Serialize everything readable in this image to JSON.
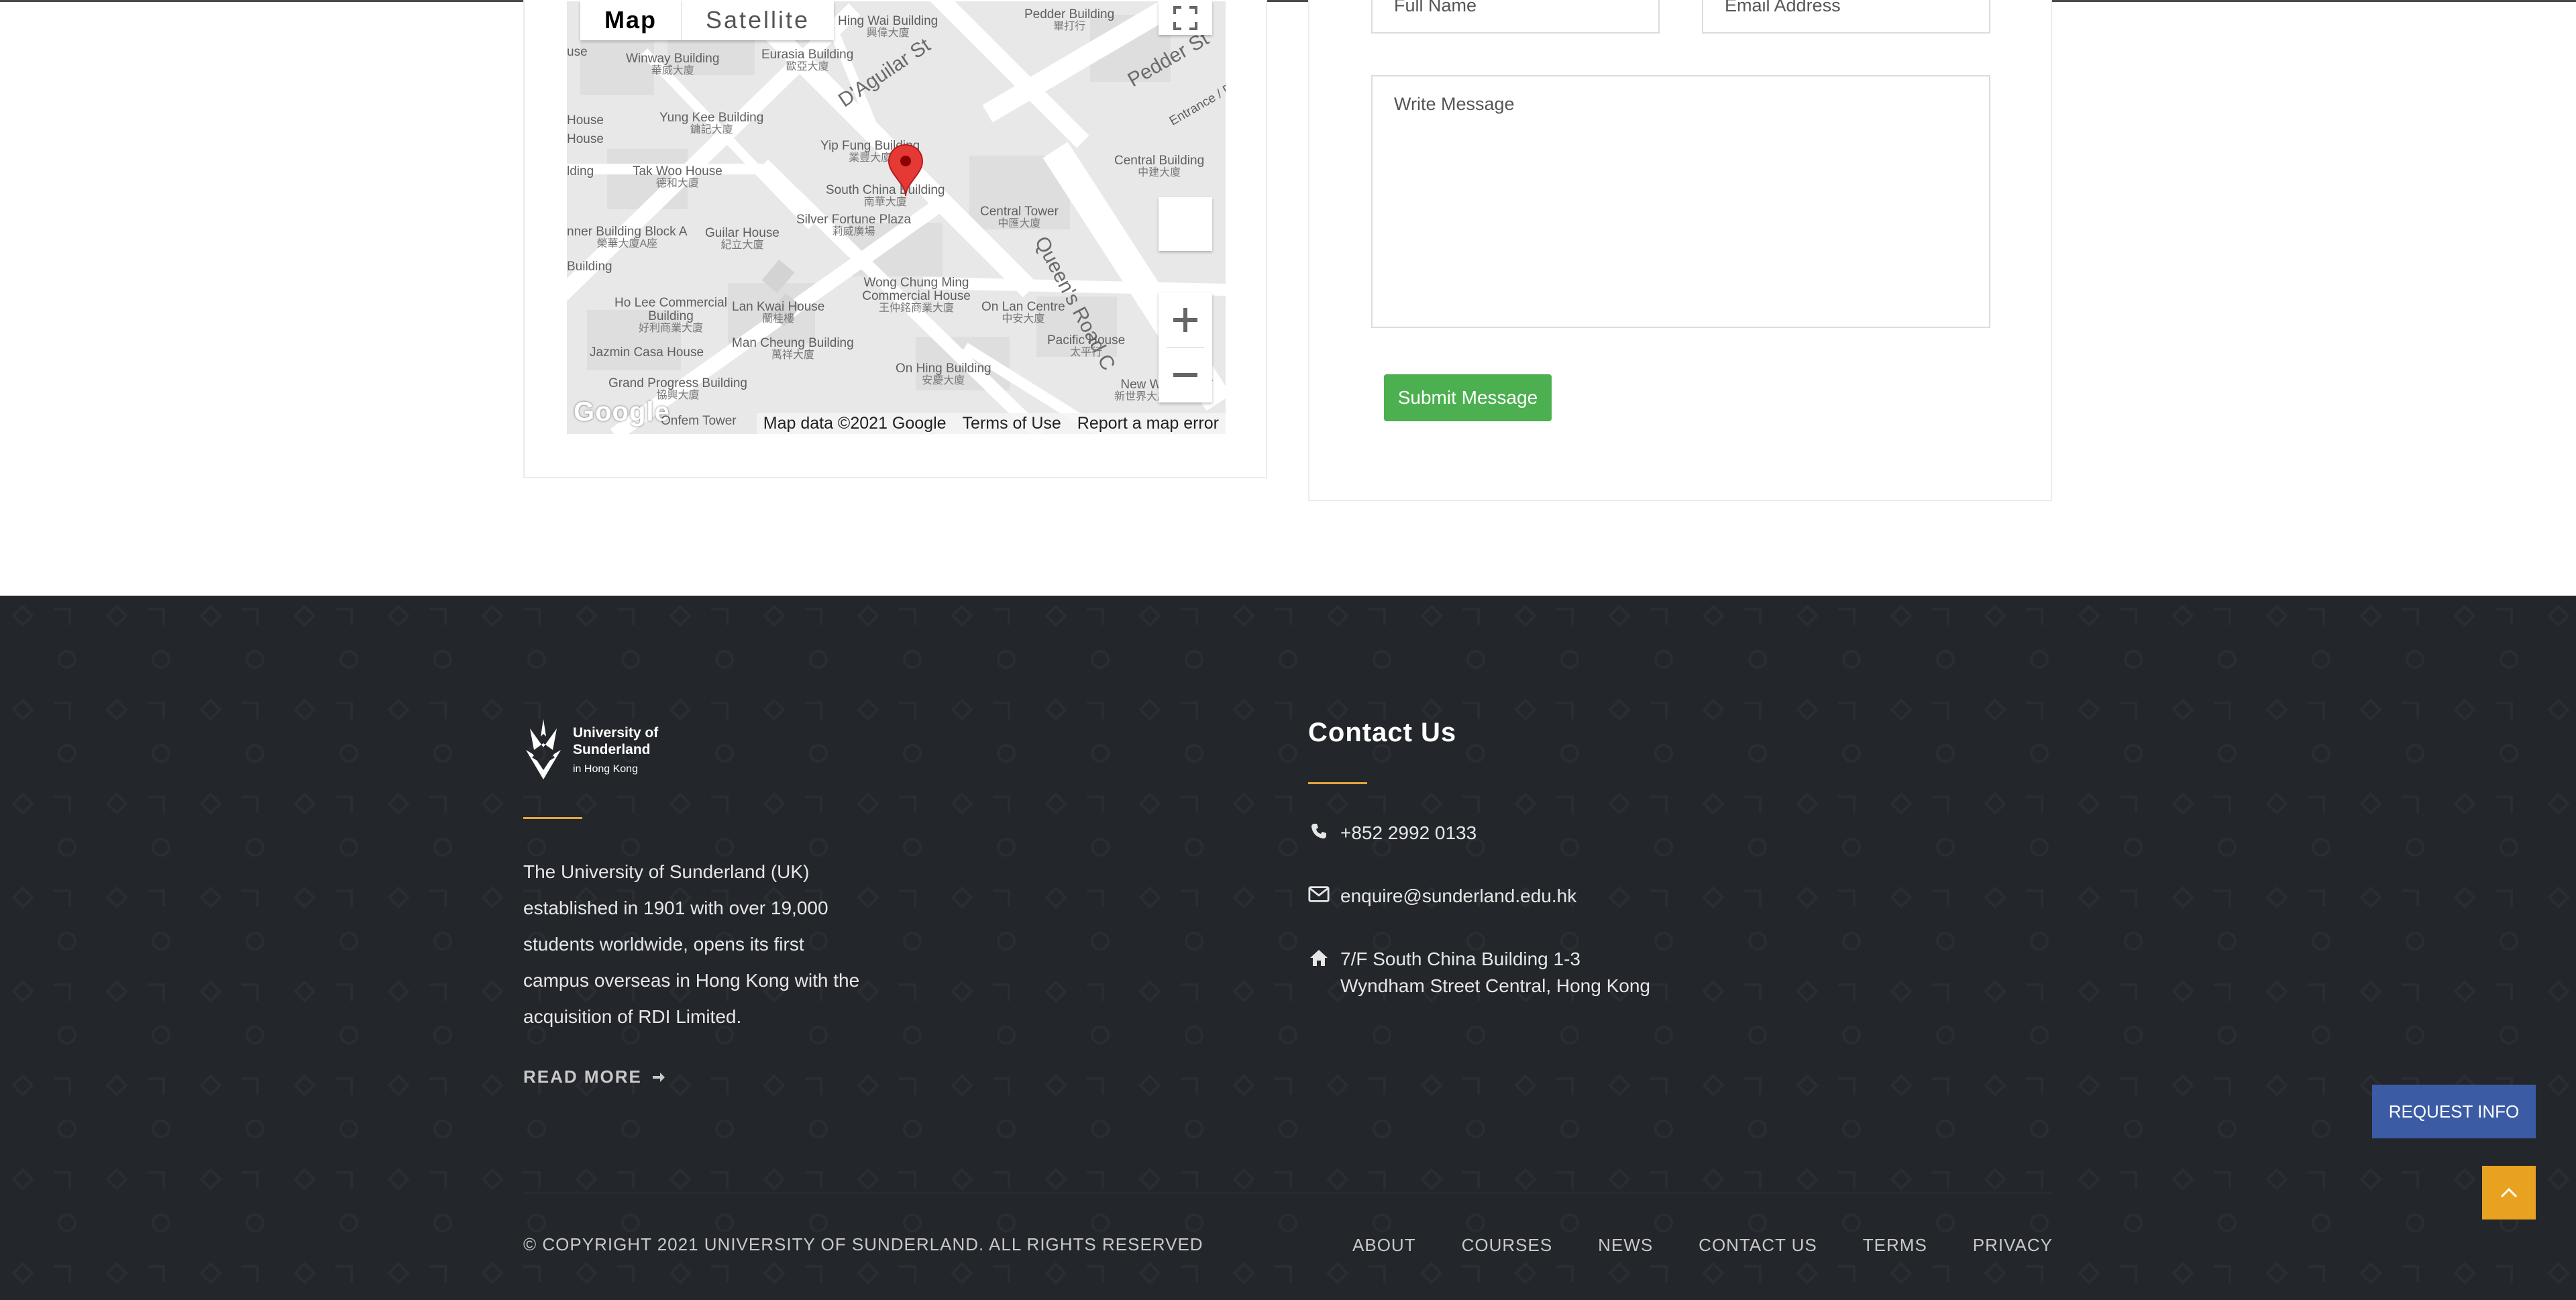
{
  "map": {
    "type_map": "Map",
    "type_satellite": "Satellite",
    "google_logo": "Google",
    "attribution": {
      "data": "Map data ©2021 Google",
      "terms": "Terms of Use",
      "report": "Report a map error"
    },
    "streets": [
      "D'Aguilar St",
      "Pedder St",
      "Queen's Road C"
    ],
    "labels": [
      {
        "en": "Hing Wai Building",
        "zh": "興偉大廈"
      },
      {
        "en": "Pedder Building",
        "zh": "畢打行"
      },
      {
        "en": "Winway Building",
        "zh": "華威大廈"
      },
      {
        "en": "Eurasia Building",
        "zh": "歐亞大廈"
      },
      {
        "en": "Yung Kee Building",
        "zh": "鏞記大廈"
      },
      {
        "en": "Entrance / Exit",
        "zh": ""
      },
      {
        "en": "Yip Fung Building",
        "zh": "業豐大廈"
      },
      {
        "en": "Central Building",
        "zh": "中建大廈"
      },
      {
        "en": "Tak Woo House",
        "zh": "德和大廈"
      },
      {
        "en": "South China Building",
        "zh": "南華大廈"
      },
      {
        "en": "Silver Fortune Plaza",
        "zh": "莉威廣場"
      },
      {
        "en": "Central Tower",
        "zh": "中匯大廈"
      },
      {
        "en": "nner Building Block A",
        "zh": "榮華大廈A座"
      },
      {
        "en": "Guilar House",
        "zh": "紀立大廈"
      },
      {
        "en": "Wong Chung Ming Commercial House",
        "zh": "王仲銘商業大廈"
      },
      {
        "en": "Ho Lee Commercial Building",
        "zh": "好利商業大廈"
      },
      {
        "en": "Lan Kwai House",
        "zh": "蘭桂樓"
      },
      {
        "en": "On Lan Centre",
        "zh": "中安大廈"
      },
      {
        "en": "Jazmin Casa House",
        "zh": ""
      },
      {
        "en": "Man Cheung Building",
        "zh": "萬祥大廈"
      },
      {
        "en": "Pacific House",
        "zh": "太平行"
      },
      {
        "en": "On Hing Building",
        "zh": "安慶大廈"
      },
      {
        "en": "Grand Progress Building",
        "zh": "協興大廈"
      },
      {
        "en": "New W",
        "zh": "新世界大廈"
      },
      {
        "en": "Onfem Tower",
        "zh": ""
      },
      {
        "en": "House",
        "zh": ""
      },
      {
        "en": "House",
        "zh": ""
      },
      {
        "en": "lding",
        "zh": ""
      },
      {
        "en": "Building",
        "zh": ""
      },
      {
        "en": "use",
        "zh": ""
      },
      {
        "en": "er",
        "zh": ""
      }
    ]
  },
  "form": {
    "full_name_placeholder": "Full Name",
    "email_placeholder": "Email Address",
    "message_placeholder": "Write Message",
    "submit_label": "Submit Message"
  },
  "footer": {
    "logo": {
      "line1": "University of",
      "line2": "Sunderland",
      "line3": "in Hong Kong"
    },
    "about_text": "The University of Sunderland (UK) established in 1901 with over 19,000 students worldwide, opens its first campus overseas in Hong Kong with the acquisition of RDI Limited.",
    "read_more": "READ MORE",
    "contact_title": "Contact Us",
    "phone": "+852 2992 0133",
    "email": "enquire@sunderland.edu.hk",
    "address_line1": "7/F South China Building 1-3",
    "address_line2": "Wyndham Street Central, Hong Kong",
    "copyright": "© COPYRIGHT 2021 UNIVERSITY OF SUNDERLAND. ALL RIGHTS RESERVED",
    "nav": [
      "ABOUT",
      "COURSES",
      "NEWS",
      "CONTACT US",
      "TERMS",
      "PRIVACY"
    ]
  },
  "floating": {
    "request_info": "REQUEST INFO"
  },
  "colors": {
    "footer_bg": "#23262b",
    "accent_gold": "#e3a53c",
    "submit_green": "#4caf50",
    "request_blue": "#3b5ba5",
    "to_top_orange": "#e8a21f",
    "marker_red": "#e53935"
  },
  "icons": {
    "fullscreen": "fullscreen-icon",
    "pegman": "pegman-icon",
    "zoom_in": "plus-icon",
    "zoom_out": "minus-icon",
    "marker": "map-marker-icon",
    "phone": "phone-icon",
    "email": "envelope-icon",
    "address": "home-icon",
    "read_more": "arrow-right-icon",
    "to_top": "chevron-up-icon"
  }
}
